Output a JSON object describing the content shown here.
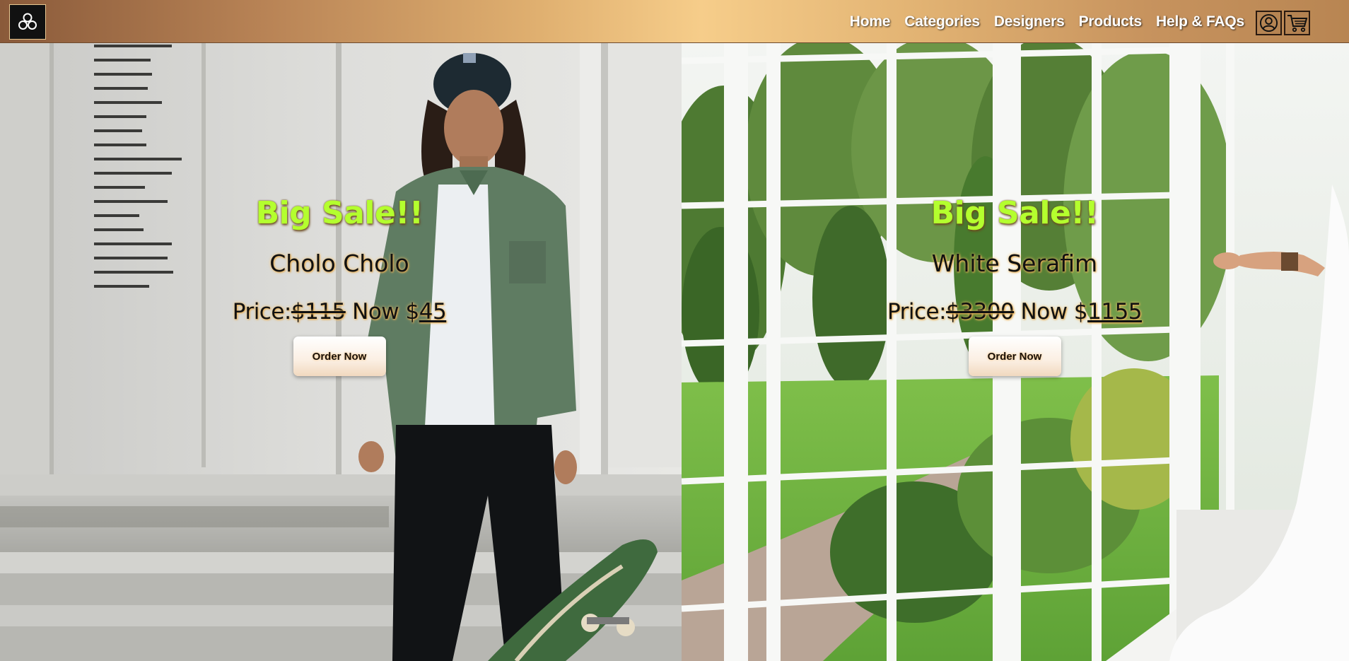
{
  "nav": {
    "links": [
      "Home",
      "Categories",
      "Designers",
      "Products",
      "Help & FAQs"
    ],
    "icons": [
      "brand-logo-icon",
      "account-icon",
      "cart-icon"
    ]
  },
  "promos": [
    {
      "headline": "Big Sale!!",
      "product": "Cholo Cholo",
      "price_prefix": "Price:",
      "old_price": "$115",
      "now_label": "Now",
      "currency": "$",
      "new_price": "45",
      "button": "Order Now"
    },
    {
      "headline": "Big Sale!!",
      "product": "White Serafim",
      "price_prefix": "Price:",
      "old_price": "$3300",
      "now_label": "Now",
      "currency": "$",
      "new_price": "1155",
      "button": "Order Now"
    }
  ],
  "colors": {
    "headline": "#b4ff2e",
    "nav_gradient_center": "#f6cd8a"
  }
}
